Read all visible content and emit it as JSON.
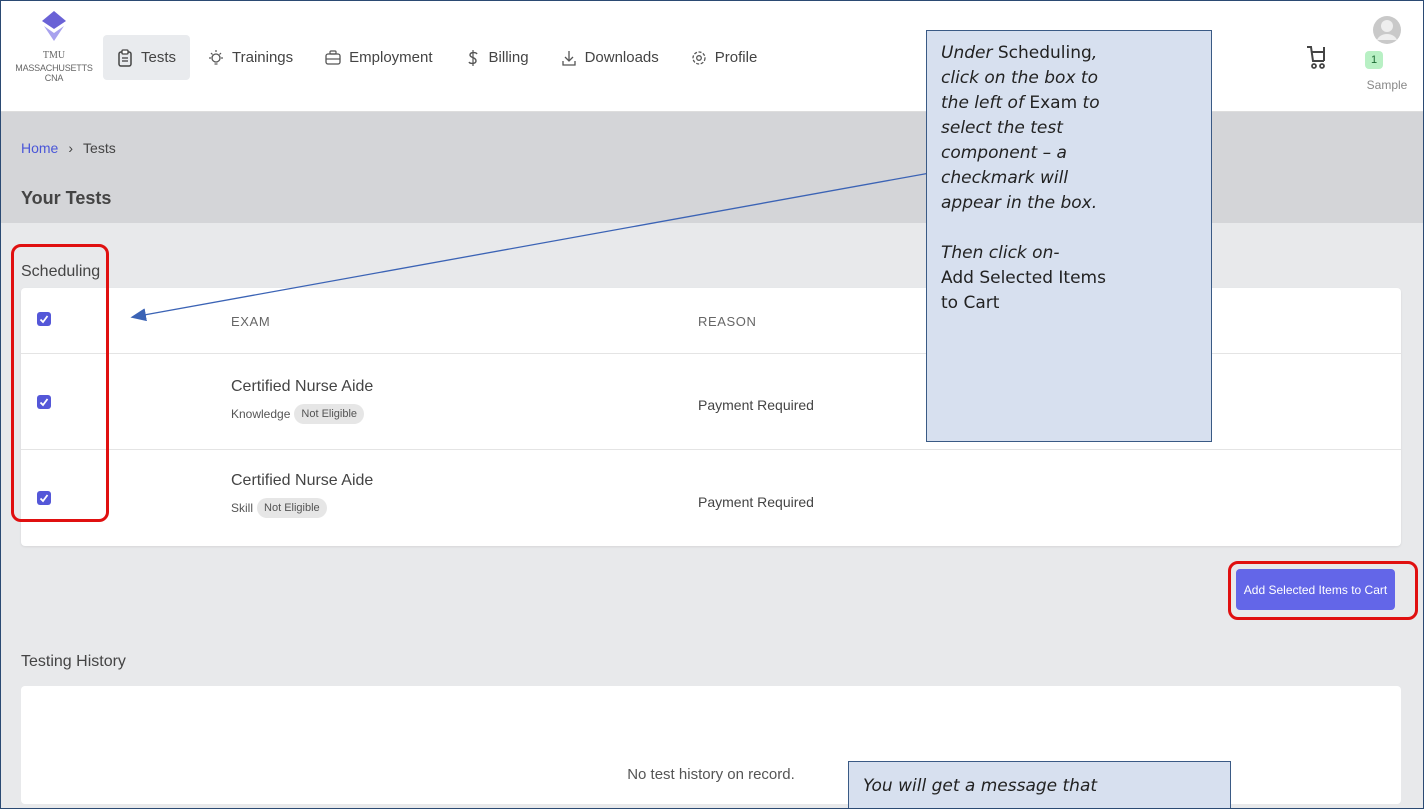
{
  "logo": {
    "line1": "TMU",
    "line2": "MASSACHUSETTS CNA"
  },
  "nav": {
    "items": [
      {
        "label": "Tests",
        "icon": "clipboard-icon",
        "active": true
      },
      {
        "label": "Trainings",
        "icon": "lightbulb-icon"
      },
      {
        "label": "Employment",
        "icon": "briefcase-icon"
      },
      {
        "label": "Billing",
        "icon": "dollar-icon"
      },
      {
        "label": "Downloads",
        "icon": "download-icon"
      },
      {
        "label": "Profile",
        "icon": "gear-icon"
      }
    ]
  },
  "header": {
    "cart_icon": "cart-icon",
    "cart_count": "1",
    "user_name": "Sample"
  },
  "breadcrumb": {
    "home": "Home",
    "separator": "›",
    "current": "Tests"
  },
  "page_title": "Your Tests",
  "scheduling": {
    "label": "Scheduling",
    "columns": {
      "exam": "EXAM",
      "reason": "REASON"
    },
    "rows": [
      {
        "title": "Certified Nurse Aide",
        "type": "Knowledge",
        "status": "Not Eligible",
        "reason": "Payment Required",
        "checked": true
      },
      {
        "title": "Certified Nurse Aide",
        "type": "Skill",
        "status": "Not Eligible",
        "reason": "Payment Required",
        "checked": true
      }
    ]
  },
  "add_button_label": "Add Selected Items to Cart",
  "testing_history": {
    "label": "Testing History",
    "empty_message": "No test history on record."
  },
  "callout_main": {
    "l1_a": "Under ",
    "l1_b": "Scheduling",
    "l1_c": ",",
    "l2": "click on the box to",
    "l3_a": "the left of ",
    "l3_b": "Exam",
    "l3_c": " to",
    "l4": "select the test",
    "l5": "component – a",
    "l6": "checkmark will",
    "l7": "appear in the box.",
    "l8": "Then click on-",
    "l9": "Add Selected Items",
    "l10": "to Cart"
  },
  "callout_bottom": {
    "text": "You will get a message that"
  },
  "colors": {
    "accent": "#6366e8",
    "highlight": "#e01010",
    "callout_bg": "#d7e0ef",
    "callout_border": "#3a5a85"
  }
}
